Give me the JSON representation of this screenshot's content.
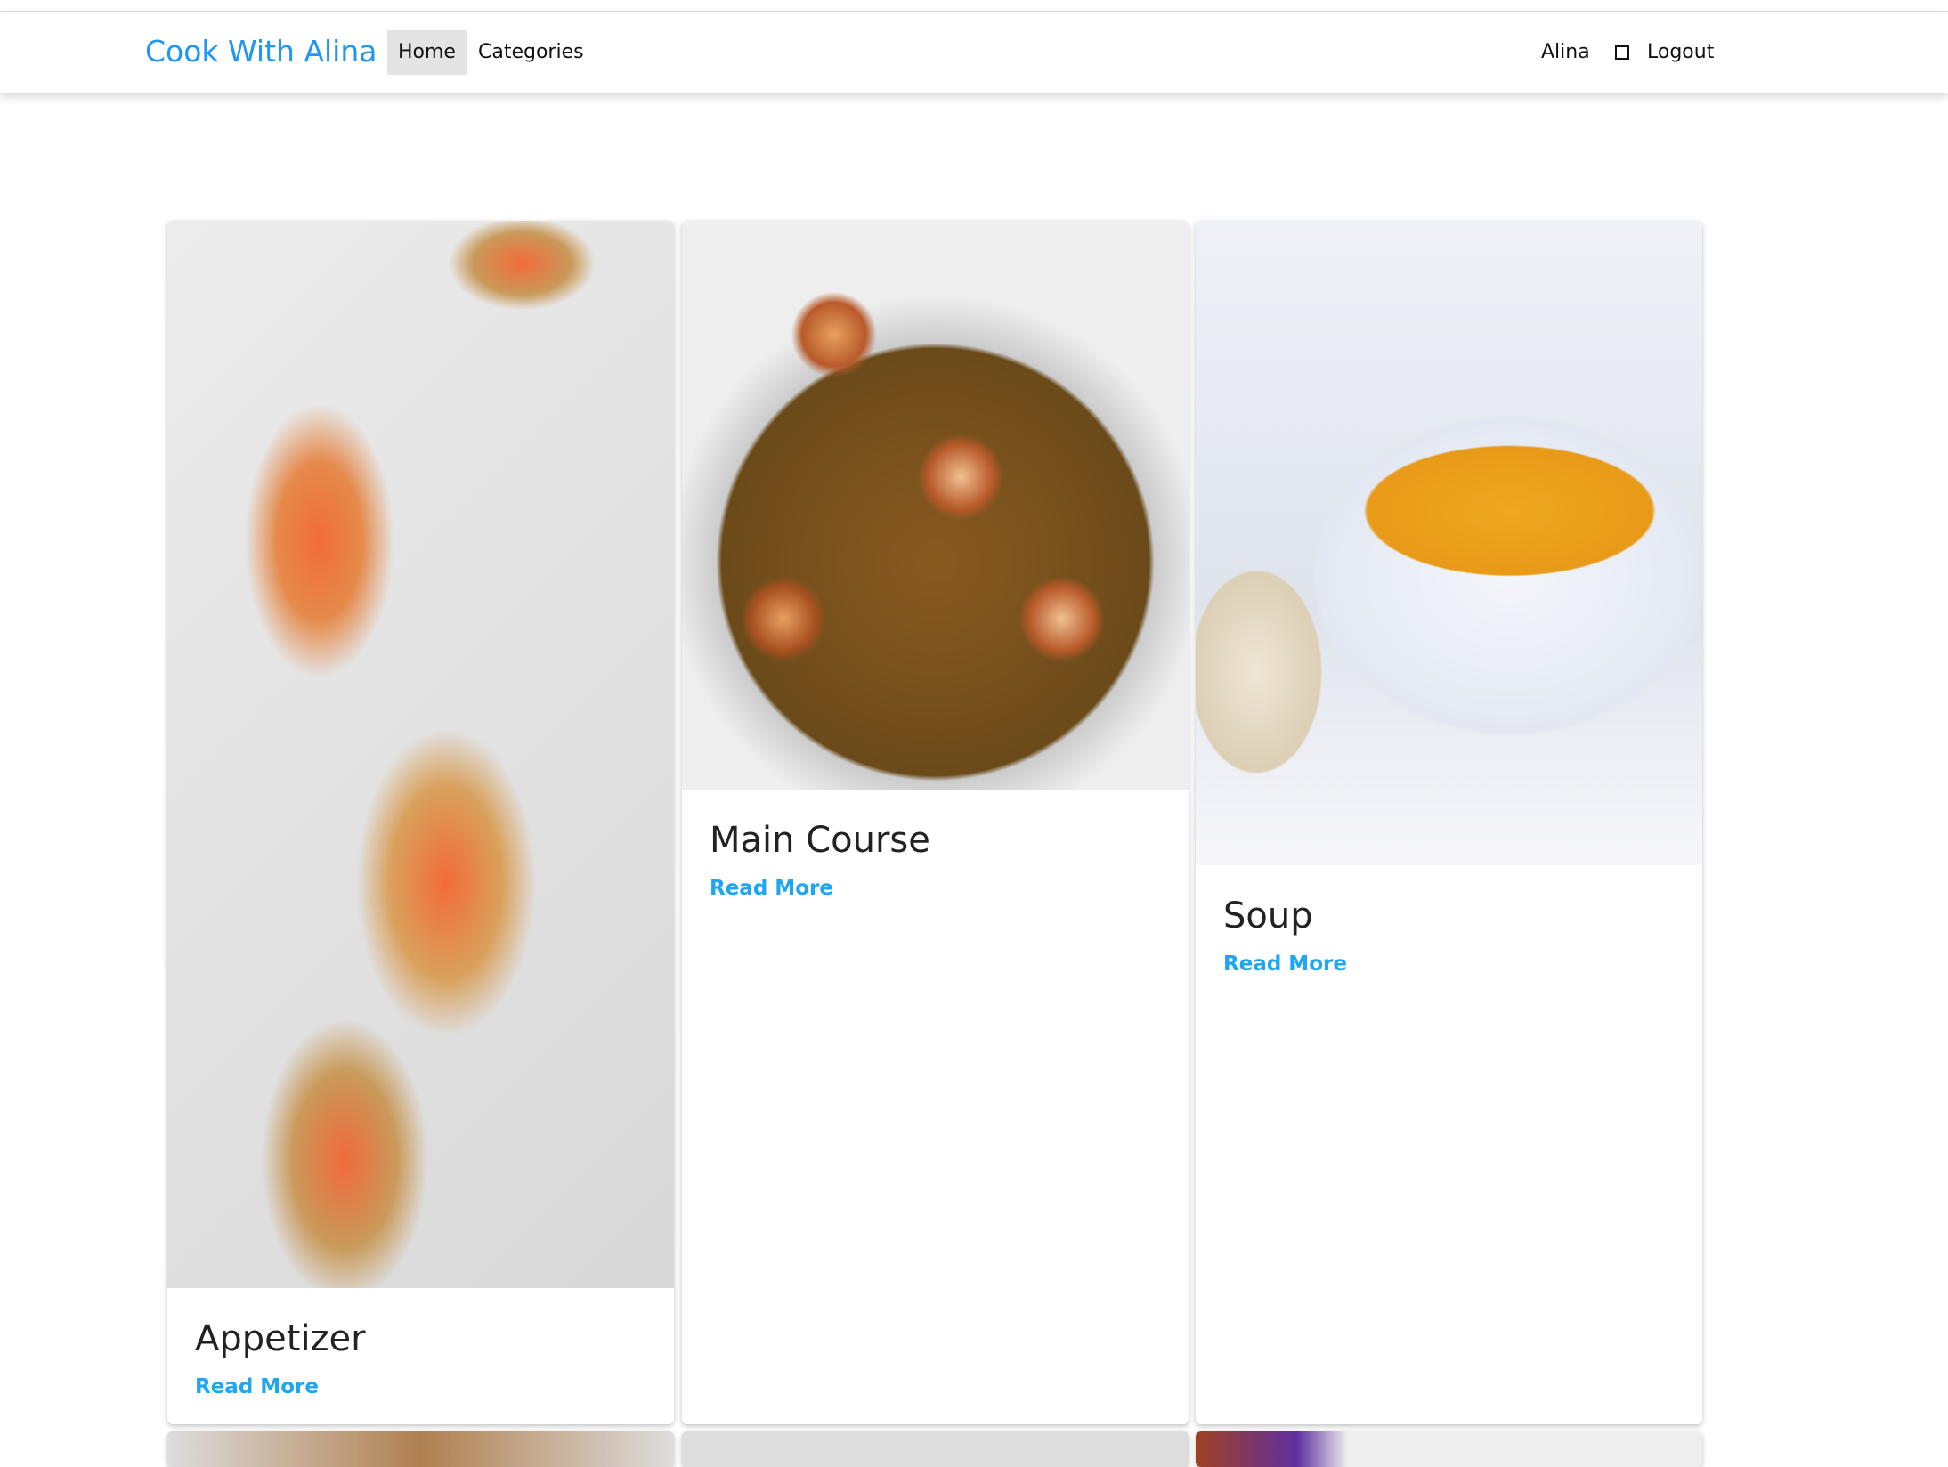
{
  "navbar": {
    "brand": "Cook With Alina",
    "links": [
      {
        "label": "Home",
        "active": true
      },
      {
        "label": "Categories",
        "active": false
      }
    ],
    "user": "Alina",
    "logout_label": "Logout",
    "logout_icon": "square-icon"
  },
  "cards": [
    {
      "title": "Appetizer",
      "link": "Read More",
      "image": "smoked salmon potato bites"
    },
    {
      "title": "Main Course",
      "link": "Read More",
      "image": "seared scallops with capers"
    },
    {
      "title": "Soup",
      "link": "Read More",
      "image": "butternut squash soup bowl with bread"
    }
  ],
  "colors": {
    "brand": "#2196f3",
    "link": "#1ea7f0",
    "active_nav_bg": "#e4e4e4"
  }
}
